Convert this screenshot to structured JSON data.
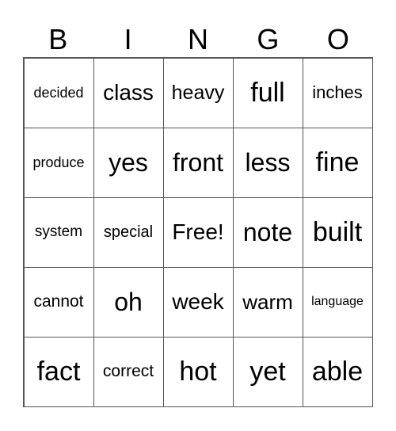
{
  "header": [
    "B",
    "I",
    "N",
    "G",
    "O"
  ],
  "cells": [
    [
      "decided",
      "class",
      "heavy",
      "full",
      "inches"
    ],
    [
      "produce",
      "yes",
      "front",
      "less",
      "fine"
    ],
    [
      "system",
      "special",
      "Free!",
      "note",
      "built"
    ],
    [
      "cannot",
      "oh",
      "week",
      "warm",
      "language"
    ],
    [
      "fact",
      "correct",
      "hot",
      "yet",
      "able"
    ]
  ]
}
